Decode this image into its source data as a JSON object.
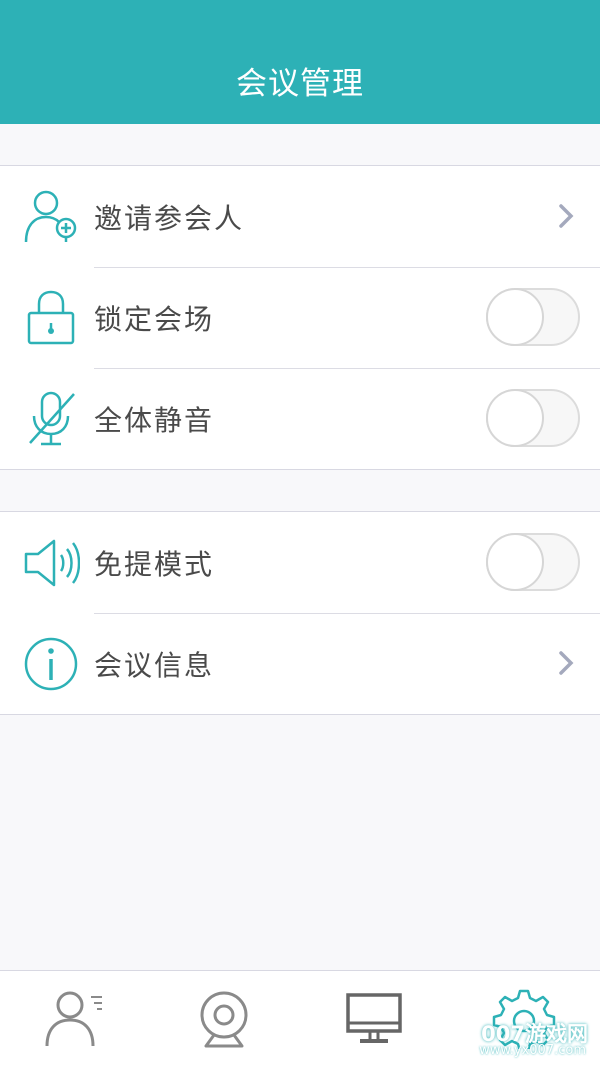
{
  "header": {
    "title": "会议管理"
  },
  "group1": [
    {
      "label": "邀请参会人",
      "icon": "add-user-icon",
      "control": "chevron"
    },
    {
      "label": "锁定会场",
      "icon": "lock-icon",
      "control": "toggle",
      "on": false
    },
    {
      "label": "全体静音",
      "icon": "mute-microphone-icon",
      "control": "toggle",
      "on": false
    }
  ],
  "group2": [
    {
      "label": "免提模式",
      "icon": "speaker-icon",
      "control": "toggle",
      "on": false
    },
    {
      "label": "会议信息",
      "icon": "info-icon",
      "control": "chevron"
    }
  ],
  "tabbar": {
    "tabs": [
      {
        "icon": "contacts-icon"
      },
      {
        "icon": "camera-icon"
      },
      {
        "icon": "monitor-icon"
      },
      {
        "icon": "settings-gear-icon",
        "active": true
      }
    ]
  },
  "watermark": {
    "brand": "007游戏网",
    "url": "www.yx007.com"
  },
  "colors": {
    "accent": "#2db1b6",
    "background": "#f8f8fa",
    "text": "#4a4a4a",
    "tab_icon": "#8a8a8a"
  }
}
